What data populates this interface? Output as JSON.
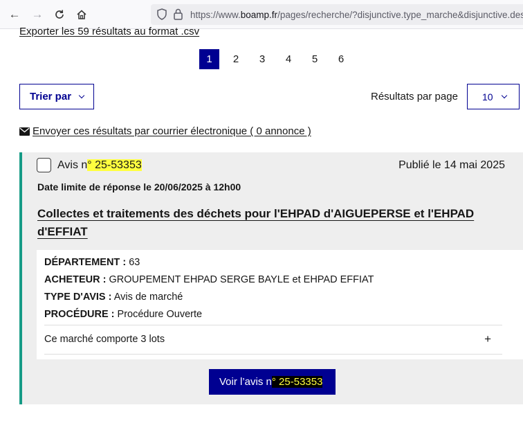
{
  "browser": {
    "url_prefix": "https://www.",
    "url_host": "boamp.fr",
    "url_rest": "/pages/recherche/?disjunctive.type_marche&disjunctive.descripte"
  },
  "results": {
    "export_link": "Exporter les 59 résultats au format .csv",
    "pagination": [
      "1",
      "2",
      "3",
      "4",
      "5",
      "6"
    ],
    "current_page": "1",
    "sort_label": "Trier par",
    "per_page_label": "Résultats par page",
    "per_page_value": "10",
    "email_link": "Envoyer ces résultats par courrier électronique ( 0 annonce )"
  },
  "notice": {
    "avis_prefix": "Avis n",
    "avis_number": "° 25-53353",
    "published": "Publié le 14 mai 2025",
    "deadline": "Date limite de réponse le 20/06/2025 à 12h00",
    "title": "Collectes et traitements des déchets pour l'EHPAD d'AIGUEPERSE et l'EHPAD d'EFFIAT",
    "departement_label": "DÉPARTEMENT :",
    "departement_value": "63",
    "acheteur_label": "ACHETEUR :",
    "acheteur_value": "GROUPEMENT EHPAD SERGE BAYLE et EHPAD EFFIAT",
    "type_label": "TYPE D'AVIS :",
    "type_value": "Avis de marché",
    "procedure_label": "PROCÉDURE :",
    "procedure_value": "Procédure Ouverte",
    "lots_text": "Ce marché comporte 3 lots",
    "lots_toggle": "+",
    "voir_prefix": "Voir l’avis n",
    "voir_number": "° 25-53353"
  }
}
